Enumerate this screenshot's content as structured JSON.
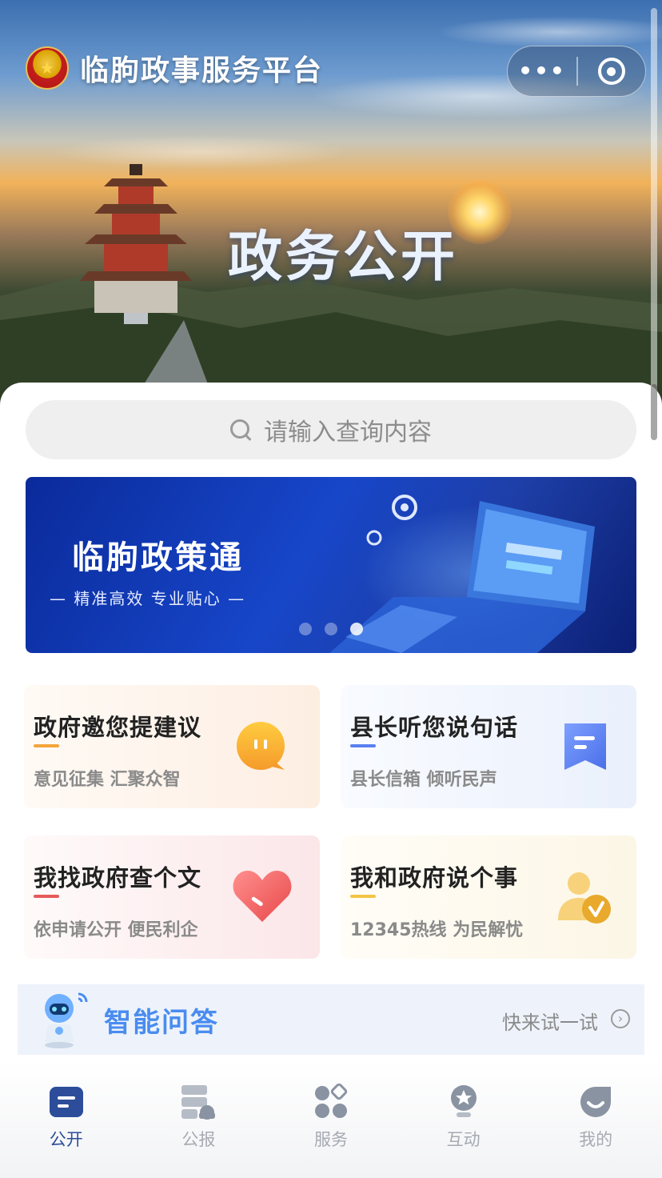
{
  "header": {
    "app_name": "临朐政事服务平台",
    "banner_text": "政务公开",
    "capsule_more": "•••"
  },
  "search": {
    "placeholder": "请输入查询内容"
  },
  "carousel": {
    "title": "临朐政策通",
    "subtitle": "— 精准高效  专业贴心 —",
    "slide_count": 3,
    "active_index": 2
  },
  "cards": [
    {
      "title": "政府邀您提建议",
      "subtitle": "意见征集 汇聚众智",
      "icon": "chat-bubble-icon",
      "accent": "#f5a43b"
    },
    {
      "title": "县长听您说句话",
      "subtitle": "县长信箱 倾听民声",
      "icon": "message-icon",
      "accent": "#5a7ff0"
    },
    {
      "title": "我找政府查个文",
      "subtitle": "依申请公开 便民利企",
      "icon": "heart-icon",
      "accent": "#e65a5a"
    },
    {
      "title": "我和政府说个事",
      "subtitle": "12345热线 为民解忧",
      "icon": "user-check-icon",
      "accent": "#f2c544"
    }
  ],
  "qa": {
    "title": "智能问答",
    "cta": "快来试一试",
    "arrow": "›"
  },
  "tabbar": {
    "items": [
      {
        "label": "公开",
        "icon": "doc-icon",
        "active": true
      },
      {
        "label": "公报",
        "icon": "report-icon",
        "active": false
      },
      {
        "label": "服务",
        "icon": "grid-icon",
        "active": false
      },
      {
        "label": "互动",
        "icon": "interact-icon",
        "active": false
      },
      {
        "label": "我的",
        "icon": "profile-icon",
        "active": false
      }
    ]
  },
  "colors": {
    "brand_blue": "#2d4d9a",
    "tab_inactive": "#a6aab3",
    "qa_title": "#4a8cf0"
  }
}
